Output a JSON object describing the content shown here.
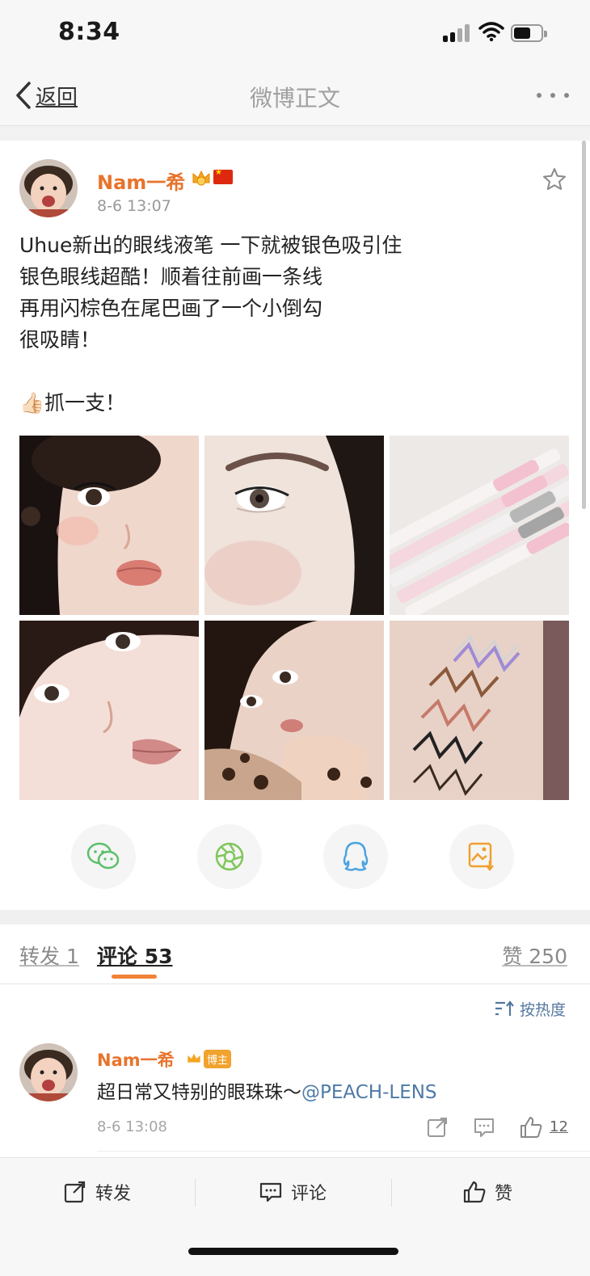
{
  "status_bar": {
    "time": "8:34"
  },
  "nav": {
    "back_label": "返回",
    "title": "微博正文"
  },
  "post": {
    "author": "Nam一希",
    "time": "8-6 13:07",
    "text_lines": [
      "Uhue新出的眼线液笔 一下就被银色吸引住",
      "银色眼线超酷！顺着往前画一条线",
      "再用闪棕色在尾巴画了一个小倒勾",
      "很吸睛！",
      "",
      "👍🏻抓一支！"
    ],
    "images": [
      {
        "name": "selfie-closeup",
        "palette": [
          "#f0d7cc",
          "#e2b7a8",
          "#1a1210"
        ]
      },
      {
        "name": "eye-makeup-closeup",
        "palette": [
          "#efe3dc",
          "#d9c3b8",
          "#1e1714"
        ]
      },
      {
        "name": "eyeliner-pens",
        "palette": [
          "#ece9e7",
          "#f4c9d4",
          "#b7b7b7"
        ]
      },
      {
        "name": "selfie-lips",
        "palette": [
          "#f3dfd7",
          "#e6b3b3",
          "#2a1a15"
        ]
      },
      {
        "name": "selfie-hand",
        "palette": [
          "#ead3c6",
          "#cfa18b",
          "#231610"
        ]
      },
      {
        "name": "swatch-arm",
        "palette": [
          "#e8d2c7",
          "#a08bd6",
          "#8b5a3c"
        ]
      }
    ]
  },
  "share": [
    "wechat-share",
    "moments-share",
    "qq-share",
    "save-image"
  ],
  "tabs": {
    "repost": "转发 1",
    "comments": "评论 53",
    "likes": "赞 250"
  },
  "sort_label": "按热度",
  "comment": {
    "author": "Nam一希",
    "badge": "博主",
    "text": "超日常又特别的眼珠珠～",
    "mention": "@PEACH-LENS",
    "time": "8-6 13:08",
    "like_count": "12"
  },
  "bottom_bar": {
    "repost": "转发",
    "comment": "评论",
    "like": "赞"
  },
  "colors": {
    "accent": "#e8742c",
    "link": "#4e7aa8",
    "tab_indicator": "#f08336"
  }
}
